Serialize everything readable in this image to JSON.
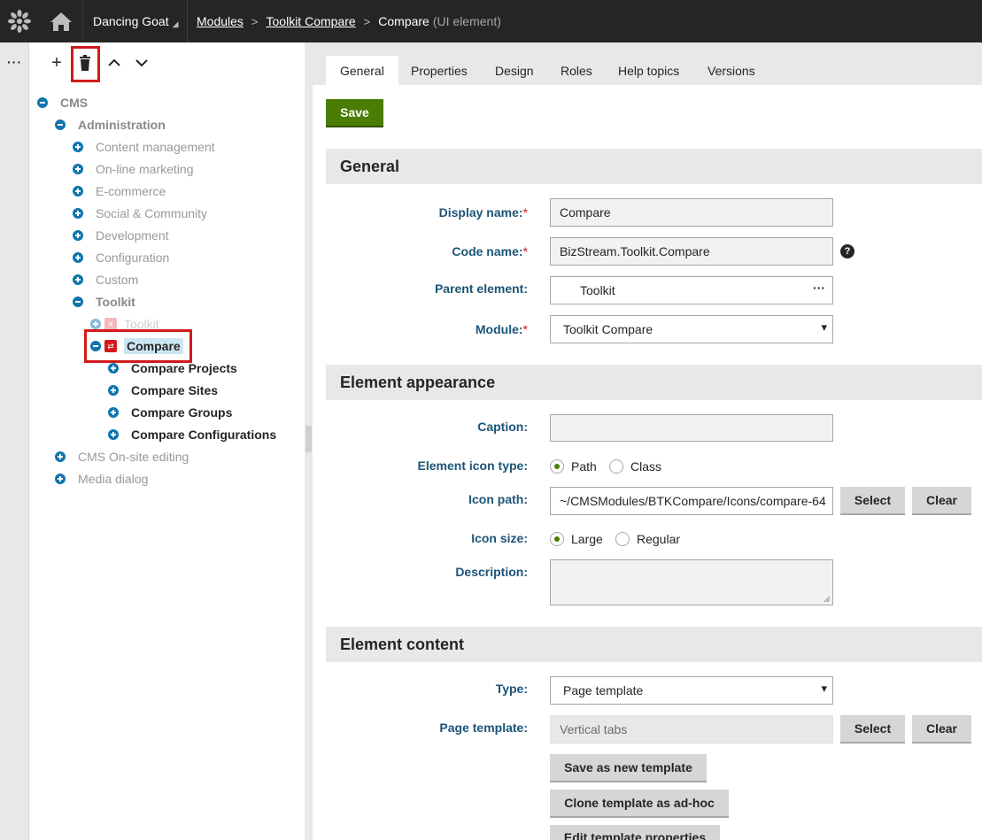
{
  "topbar": {
    "site_name": "Dancing Goat",
    "breadcrumb": {
      "modules": "Modules",
      "toolkit_compare": "Toolkit Compare",
      "current": "Compare",
      "current_type": "(UI element)"
    }
  },
  "sidebar": {
    "more": "···"
  },
  "tree_toolbar": {
    "add": "+",
    "up": "∧",
    "down": "∨"
  },
  "tree": {
    "root": "CMS",
    "administration": "Administration",
    "items": [
      "Content management",
      "On-line marketing",
      "E-commerce",
      "Social & Community",
      "Development",
      "Configuration",
      "Custom"
    ],
    "toolkit_parent": "Toolkit",
    "toolkit_child": "Toolkit",
    "compare": "Compare",
    "compare_children": [
      "Compare Projects",
      "Compare Sites",
      "Compare Groups",
      "Compare Configurations"
    ],
    "onsite": "CMS On-site editing",
    "media": "Media dialog"
  },
  "tabs": [
    "General",
    "Properties",
    "Design",
    "Roles",
    "Help topics",
    "Versions"
  ],
  "save_label": "Save",
  "sections": {
    "general": "General",
    "appearance": "Element appearance",
    "content": "Element content"
  },
  "form": {
    "display_name_label": "Display name:",
    "display_name_value": "Compare",
    "code_name_label": "Code name:",
    "code_name_value": "BizStream.Toolkit.Compare",
    "parent_label": "Parent element:",
    "parent_value": "Toolkit",
    "parent_more": "···",
    "module_label": "Module:",
    "module_value": "Toolkit Compare",
    "caption_label": "Caption:",
    "caption_value": "",
    "icon_type_label": "Element icon type:",
    "icon_type_options": [
      "Path",
      "Class"
    ],
    "icon_type_selected": "Path",
    "icon_path_label": "Icon path:",
    "icon_path_value": "~/CMSModules/BTKCompare/Icons/compare-64",
    "icon_size_label": "Icon size:",
    "icon_size_options": [
      "Large",
      "Regular"
    ],
    "icon_size_selected": "Large",
    "description_label": "Description:",
    "type_label": "Type:",
    "type_value": "Page template",
    "page_template_label": "Page template:",
    "page_template_value": "Vertical tabs",
    "select_label": "Select",
    "clear_label": "Clear",
    "save_new_template": "Save as new template",
    "clone_template": "Clone template as ad-hoc",
    "edit_template": "Edit template properties",
    "required_mark": "*",
    "help_mark": "?"
  },
  "colors": {
    "topbar": "#262524",
    "save_green": "#497d04",
    "label_blue": "#1c5478",
    "tree_toggle": "#1175ae",
    "highlight_red": "#d11a1a"
  }
}
